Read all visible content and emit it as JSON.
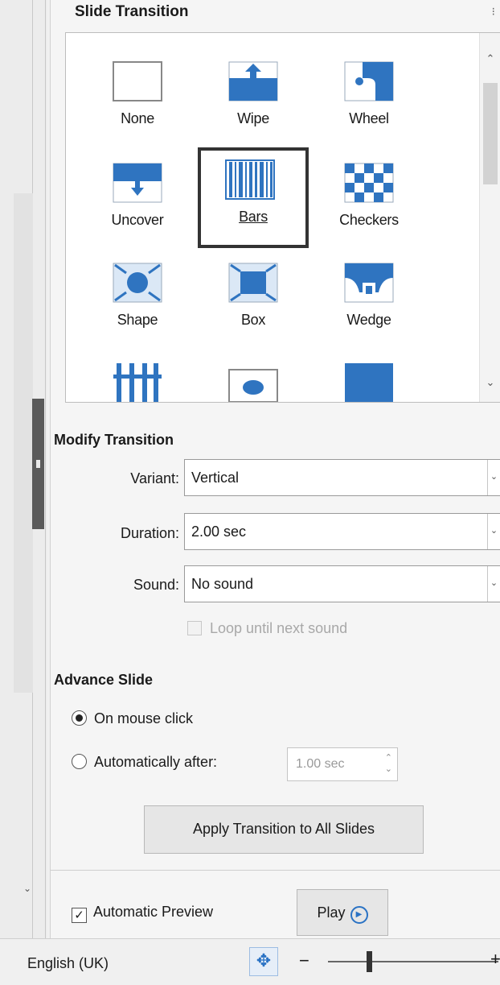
{
  "panel": {
    "title": "Slide Transition"
  },
  "gallery": {
    "items": [
      {
        "label": "None",
        "icon": "none-icon"
      },
      {
        "label": "Wipe",
        "icon": "wipe-icon"
      },
      {
        "label": "Wheel",
        "icon": "wheel-icon"
      },
      {
        "label": "Uncover",
        "icon": "uncover-icon"
      },
      {
        "label": "Bars",
        "icon": "bars-icon",
        "selected": true
      },
      {
        "label": "Checkers",
        "icon": "checkers-icon"
      },
      {
        "label": "Shape",
        "icon": "shape-icon"
      },
      {
        "label": "Box",
        "icon": "box-icon"
      },
      {
        "label": "Wedge",
        "icon": "wedge-icon"
      }
    ]
  },
  "modify": {
    "heading": "Modify Transition",
    "variant_label": "Variant:",
    "variant_value": "Vertical",
    "duration_label": "Duration:",
    "duration_value": "2.00 sec",
    "sound_label": "Sound:",
    "sound_value": "No sound",
    "loop_label": "Loop until next sound"
  },
  "advance": {
    "heading": "Advance Slide",
    "on_click_label": "On mouse click",
    "auto_label": "Automatically after:",
    "auto_value": "1.00 sec",
    "selected": "on_click"
  },
  "apply_button": "Apply Transition to All Slides",
  "preview": {
    "label": "Automatic Preview",
    "checked": true
  },
  "play_button": "Play",
  "status": {
    "language": "English (UK)"
  },
  "colors": {
    "accent": "#2a72c4",
    "icon_blue": "#2f74c0"
  }
}
